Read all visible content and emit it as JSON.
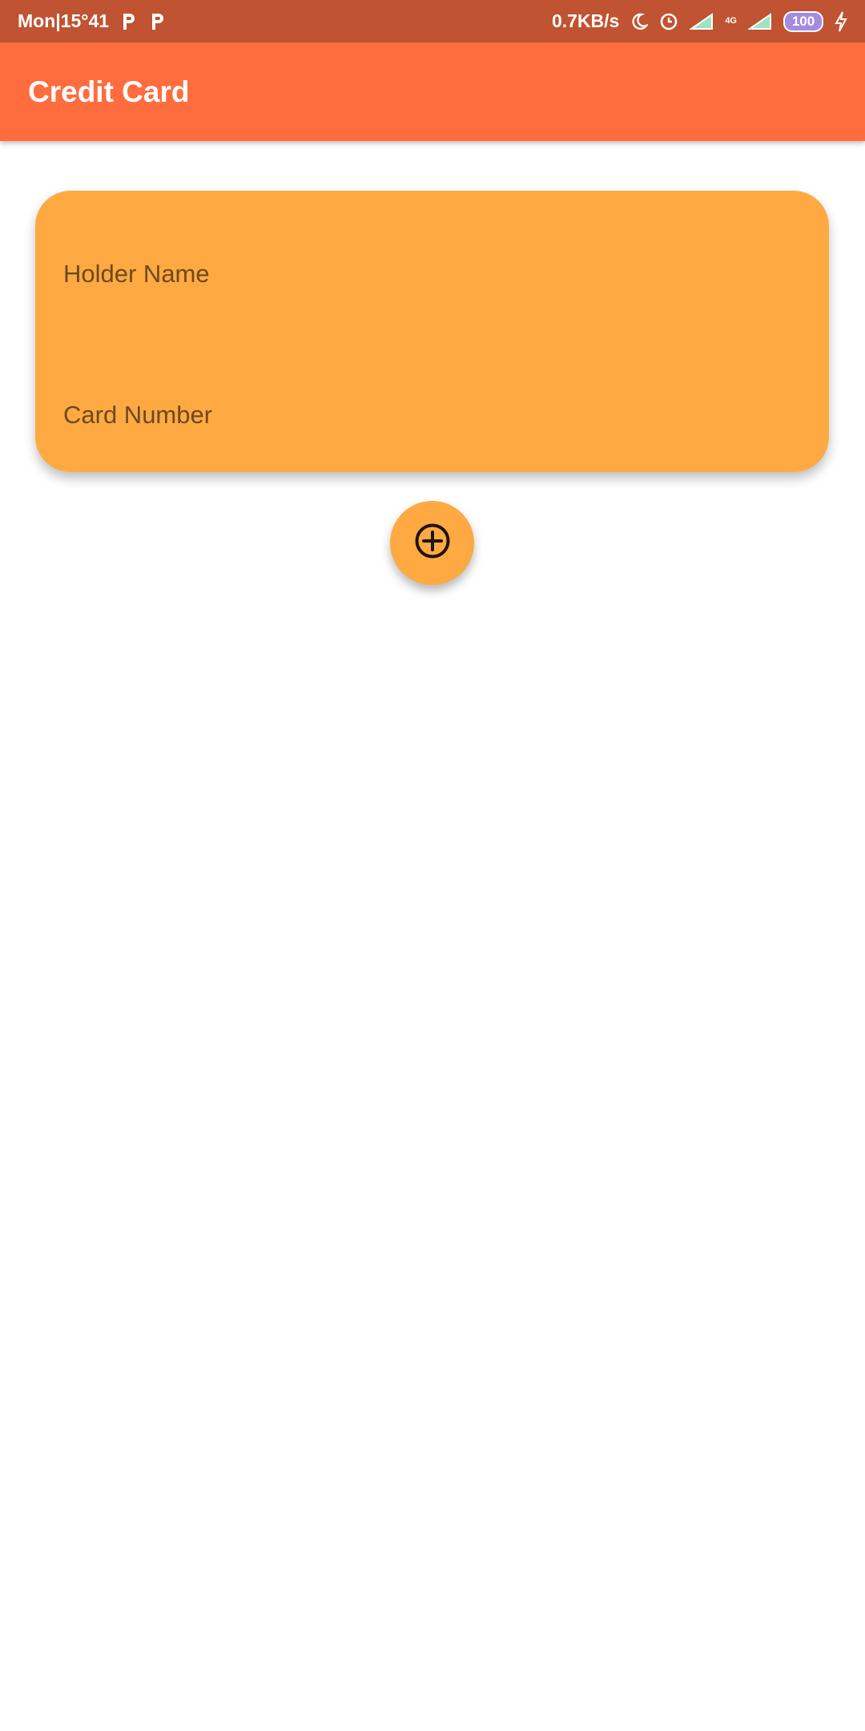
{
  "status_bar": {
    "time": "Mon|15°41",
    "network_speed": "0.7KB/s",
    "network_type": "4G",
    "battery": "100",
    "icons": [
      "p-icon",
      "p-icon",
      "moon-icon",
      "alarm-icon",
      "signal-icon",
      "signal-icon",
      "battery-icon",
      "charging-icon"
    ]
  },
  "app_bar": {
    "title": "Credit Card"
  },
  "card": {
    "holder_label": "Holder Name",
    "number_label": "Card Number"
  },
  "fab": {
    "icon": "add-circle-icon"
  },
  "colors": {
    "status_bar": "#c05331",
    "app_bar": "#ff6d3f",
    "card": "#ffa943",
    "card_text": "#6d4a1e"
  }
}
